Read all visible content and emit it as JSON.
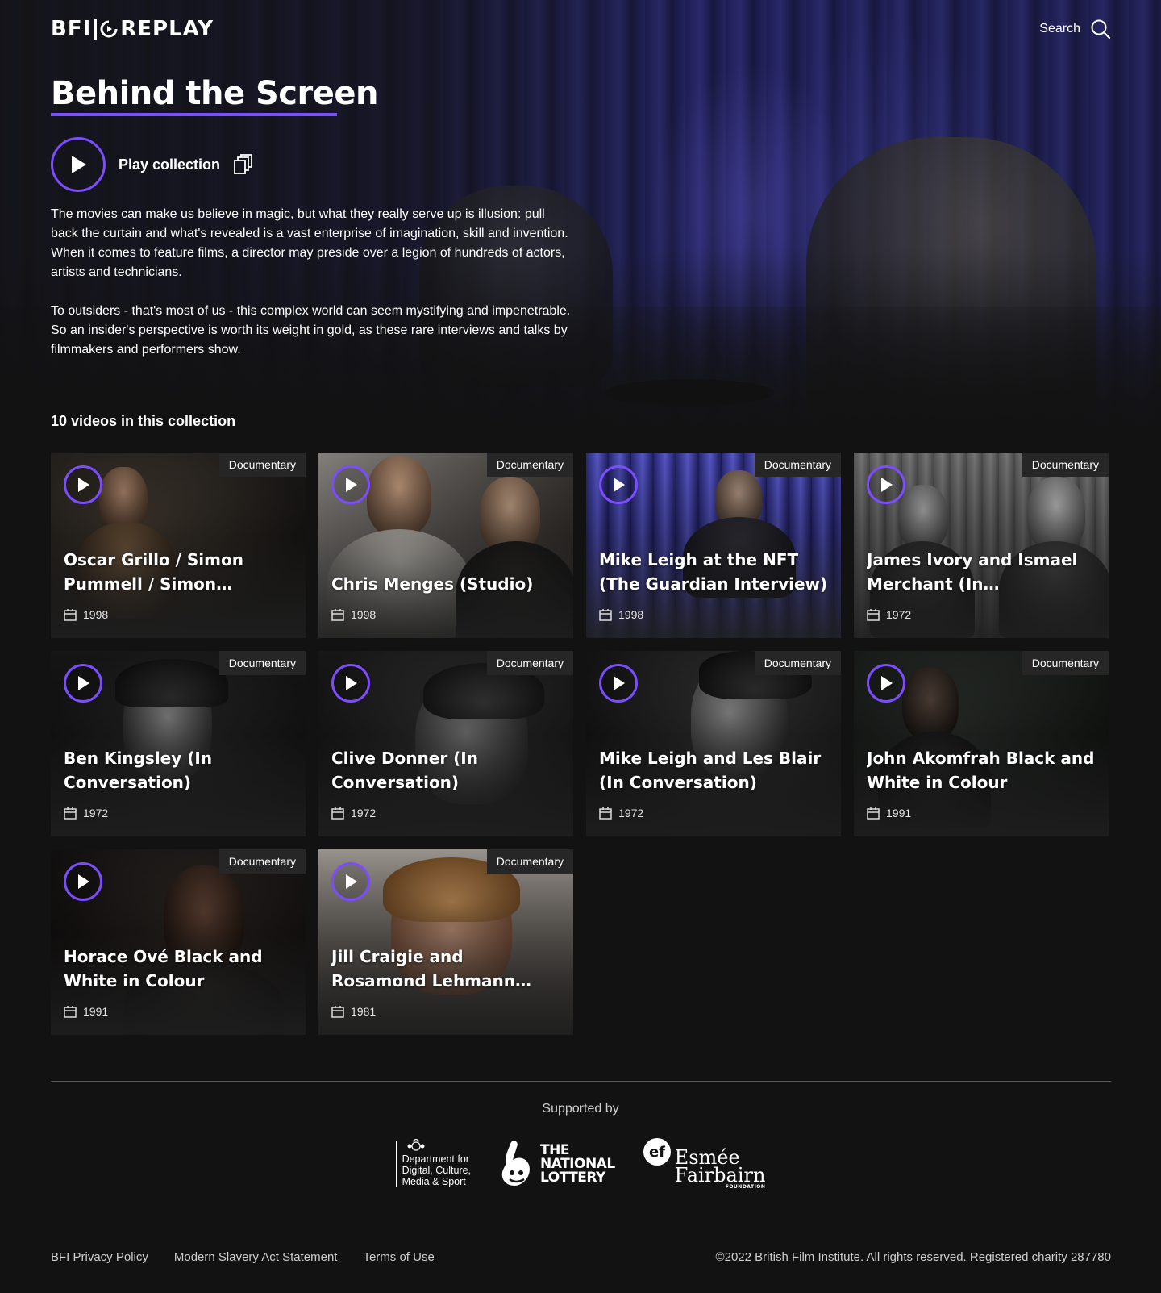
{
  "header": {
    "logo_left": "BFI",
    "logo_right": "REPLAY",
    "search_label": "Search"
  },
  "collection": {
    "title": "Behind the Screen",
    "play_label": "Play collection",
    "description": [
      "The movies can make us believe in magic, but what they really serve up is illusion: pull back the curtain and what's revealed is a vast enterprise of imagination, skill and invention. When it comes to feature films, a director may preside over a legion of hundreds of actors, artists and technicians.",
      "To outsiders - that's most of us - this complex world can seem mystifying and impenetrable. So an insider's perspective is worth its weight in gold, as these rare interviews and talks by filmmakers and performers show."
    ],
    "count_label": "10 videos in this collection"
  },
  "videos": [
    {
      "title": "Oscar Grillo / Simon Pummell / Simon Schofield...",
      "year": "1998",
      "genre": "Documentary"
    },
    {
      "title": "Chris Menges (Studio)",
      "year": "1998",
      "genre": "Documentary"
    },
    {
      "title": "Mike Leigh at the NFT (The Guardian Interview)",
      "year": "1998",
      "genre": "Documentary"
    },
    {
      "title": "James Ivory and Ismael Merchant (In Conversation)",
      "year": "1972",
      "genre": "Documentary"
    },
    {
      "title": "Ben Kingsley (In Conversation)",
      "year": "1972",
      "genre": "Documentary"
    },
    {
      "title": "Clive Donner (In Conversation)",
      "year": "1972",
      "genre": "Documentary"
    },
    {
      "title": "Mike Leigh and Les Blair (In Conversation)",
      "year": "1972",
      "genre": "Documentary"
    },
    {
      "title": "John Akomfrah Black and White in Colour",
      "year": "1991",
      "genre": "Documentary"
    },
    {
      "title": "Horace Ové Black and White in Colour",
      "year": "1991",
      "genre": "Documentary"
    },
    {
      "title": "Jill Craigie and Rosamond Lehmann (Live on Two)",
      "year": "1981",
      "genre": "Documentary"
    }
  ],
  "footer": {
    "supported_by": "Supported by",
    "dcms_lines": [
      "Department for",
      "Digital, Culture,",
      "Media & Sport"
    ],
    "lottery_lines": [
      "THE",
      "NATIONAL",
      "LOTTERY"
    ],
    "esmee_lines": [
      "Esmée",
      "Fairbairn"
    ],
    "esmee_foundation": "FOUNDATION",
    "links": [
      "BFI Privacy Policy",
      "Modern Slavery Act Statement",
      "Terms of Use"
    ],
    "copyright": "©2022 British Film Institute. All rights reserved. Registered charity 287780"
  },
  "colors": {
    "accent": "#7b4dff",
    "background": "#121212",
    "badge_bg": "#262626"
  },
  "icons": {
    "search": "search-icon",
    "play": "play-icon",
    "playlist": "playlist-icon",
    "calendar": "calendar-icon"
  }
}
